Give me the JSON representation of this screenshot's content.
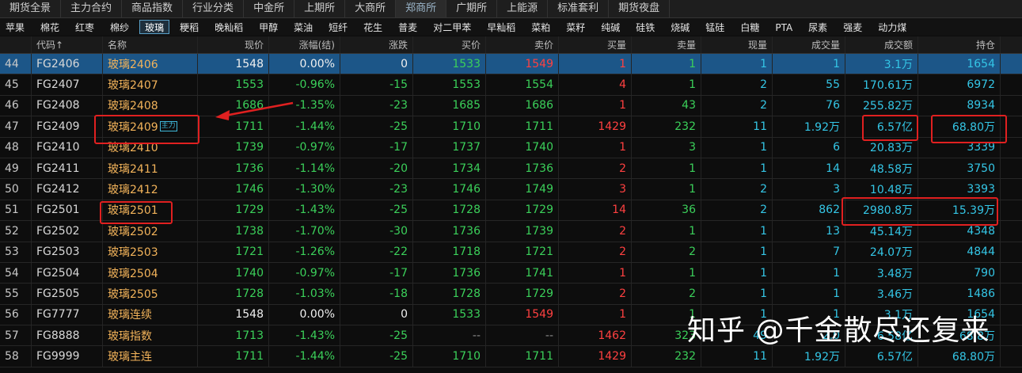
{
  "top_tabs": [
    "期货全景",
    "主力合约",
    "商品指数",
    "行业分类",
    "中金所",
    "上期所",
    "大商所",
    "郑商所",
    "广期所",
    "上能源",
    "标准套利",
    "期货夜盘"
  ],
  "top_active": 7,
  "products": [
    "苹果",
    "棉花",
    "红枣",
    "棉纱",
    "玻璃",
    "粳稻",
    "晚籼稻",
    "甲醇",
    "菜油",
    "短纤",
    "花生",
    "普麦",
    "对二甲苯",
    "早籼稻",
    "菜粕",
    "菜籽",
    "纯碱",
    "硅铁",
    "烧碱",
    "锰硅",
    "白糖",
    "PTA",
    "尿素",
    "强麦",
    "动力煤"
  ],
  "product_active": 4,
  "columns": [
    "",
    "代码↑",
    "名称",
    "现价",
    "涨幅(结)",
    "涨跌",
    "买价",
    "卖价",
    "买量",
    "卖量",
    "现量",
    "成交量",
    "成交额",
    "持仓"
  ],
  "rows": [
    {
      "no": "44",
      "code": "FG2406",
      "name": "玻璃2406",
      "price": "1548",
      "chg": "0.00%",
      "diff": "0",
      "bid": "1533",
      "ask": "1549",
      "bidv": "1",
      "askv": "1",
      "cur": "1",
      "vol": "1",
      "amt": "3.1万",
      "oi": "1654",
      "selected": true,
      "dir": "flat",
      "bidc": "green",
      "askc": "red"
    },
    {
      "no": "45",
      "code": "FG2407",
      "name": "玻璃2407",
      "price": "1553",
      "chg": "-0.96%",
      "diff": "-15",
      "bid": "1553",
      "ask": "1554",
      "bidv": "4",
      "askv": "1",
      "cur": "2",
      "vol": "55",
      "amt": "170.61万",
      "oi": "6972",
      "dir": "down",
      "bidc": "green",
      "askc": "green"
    },
    {
      "no": "46",
      "code": "FG2408",
      "name": "玻璃2408",
      "price": "1686",
      "chg": "-1.35%",
      "diff": "-23",
      "bid": "1685",
      "ask": "1686",
      "bidv": "1",
      "askv": "43",
      "cur": "2",
      "vol": "76",
      "amt": "255.82万",
      "oi": "8934",
      "dir": "down",
      "bidc": "green",
      "askc": "green"
    },
    {
      "no": "47",
      "code": "FG2409",
      "name": "玻璃2409",
      "badge": "主力",
      "price": "1711",
      "chg": "-1.44%",
      "diff": "-25",
      "bid": "1710",
      "ask": "1711",
      "bidv": "1429",
      "askv": "232",
      "cur": "11",
      "vol": "1.92万",
      "amt": "6.57亿",
      "oi": "68.80万",
      "dir": "down",
      "bidc": "green",
      "askc": "green"
    },
    {
      "no": "48",
      "code": "FG2410",
      "name": "玻璃2410",
      "price": "1739",
      "chg": "-0.97%",
      "diff": "-17",
      "bid": "1737",
      "ask": "1740",
      "bidv": "1",
      "askv": "3",
      "cur": "1",
      "vol": "6",
      "amt": "20.83万",
      "oi": "3339",
      "dir": "down",
      "bidc": "green",
      "askc": "green"
    },
    {
      "no": "49",
      "code": "FG2411",
      "name": "玻璃2411",
      "price": "1736",
      "chg": "-1.14%",
      "diff": "-20",
      "bid": "1734",
      "ask": "1736",
      "bidv": "2",
      "askv": "1",
      "cur": "1",
      "vol": "14",
      "amt": "48.58万",
      "oi": "3750",
      "dir": "down",
      "bidc": "green",
      "askc": "green"
    },
    {
      "no": "50",
      "code": "FG2412",
      "name": "玻璃2412",
      "price": "1746",
      "chg": "-1.30%",
      "diff": "-23",
      "bid": "1746",
      "ask": "1749",
      "bidv": "3",
      "askv": "1",
      "cur": "2",
      "vol": "3",
      "amt": "10.48万",
      "oi": "3393",
      "dir": "down",
      "bidc": "green",
      "askc": "green"
    },
    {
      "no": "51",
      "code": "FG2501",
      "name": "玻璃2501",
      "price": "1729",
      "chg": "-1.43%",
      "diff": "-25",
      "bid": "1728",
      "ask": "1729",
      "bidv": "14",
      "askv": "36",
      "cur": "2",
      "vol": "862",
      "amt": "2980.8万",
      "oi": "15.39万",
      "dir": "down",
      "bidc": "green",
      "askc": "green"
    },
    {
      "no": "52",
      "code": "FG2502",
      "name": "玻璃2502",
      "price": "1738",
      "chg": "-1.70%",
      "diff": "-30",
      "bid": "1736",
      "ask": "1739",
      "bidv": "2",
      "askv": "1",
      "cur": "1",
      "vol": "13",
      "amt": "45.14万",
      "oi": "4348",
      "dir": "down",
      "bidc": "green",
      "askc": "green"
    },
    {
      "no": "53",
      "code": "FG2503",
      "name": "玻璃2503",
      "price": "1721",
      "chg": "-1.26%",
      "diff": "-22",
      "bid": "1718",
      "ask": "1721",
      "bidv": "2",
      "askv": "2",
      "cur": "1",
      "vol": "7",
      "amt": "24.07万",
      "oi": "4844",
      "dir": "down",
      "bidc": "green",
      "askc": "green"
    },
    {
      "no": "54",
      "code": "FG2504",
      "name": "玻璃2504",
      "price": "1740",
      "chg": "-0.97%",
      "diff": "-17",
      "bid": "1736",
      "ask": "1741",
      "bidv": "1",
      "askv": "1",
      "cur": "1",
      "vol": "1",
      "amt": "3.48万",
      "oi": "790",
      "dir": "down",
      "bidc": "green",
      "askc": "green"
    },
    {
      "no": "55",
      "code": "FG2505",
      "name": "玻璃2505",
      "price": "1728",
      "chg": "-1.03%",
      "diff": "-18",
      "bid": "1728",
      "ask": "1729",
      "bidv": "2",
      "askv": "2",
      "cur": "1",
      "vol": "1",
      "amt": "3.46万",
      "oi": "1486",
      "dir": "down",
      "bidc": "green",
      "askc": "green"
    },
    {
      "no": "56",
      "code": "FG7777",
      "name": "玻璃连续",
      "price": "1548",
      "chg": "0.00%",
      "diff": "0",
      "bid": "1533",
      "ask": "1549",
      "bidv": "1",
      "askv": "1",
      "cur": "1",
      "vol": "1",
      "amt": "3.1万",
      "oi": "1654",
      "dir": "flat",
      "bidc": "green",
      "askc": "red"
    },
    {
      "no": "57",
      "code": "FG8888",
      "name": "玻璃指数",
      "price": "1713",
      "chg": "-1.43%",
      "diff": "-25",
      "bid": "--",
      "ask": "--",
      "bidv": "1462",
      "askv": "323",
      "cur": "49",
      "vol": "2.0",
      "amt": "6.58亿",
      "oi": "68.8万",
      "dir": "down",
      "bidc": "muted",
      "askc": "muted"
    },
    {
      "no": "58",
      "code": "FG9999",
      "name": "玻璃主连",
      "price": "1711",
      "chg": "-1.44%",
      "diff": "-25",
      "bid": "1710",
      "ask": "1711",
      "bidv": "1429",
      "askv": "232",
      "cur": "11",
      "vol": "1.92万",
      "amt": "6.57亿",
      "oi": "68.80万",
      "dir": "down",
      "bidc": "green",
      "askc": "green"
    }
  ],
  "watermark": "知乎 @千金散尽还复来",
  "colors": {
    "up": "#ff4040",
    "down": "#3bd05a",
    "cyan": "#34c6e6",
    "annotation": "#e02020"
  }
}
